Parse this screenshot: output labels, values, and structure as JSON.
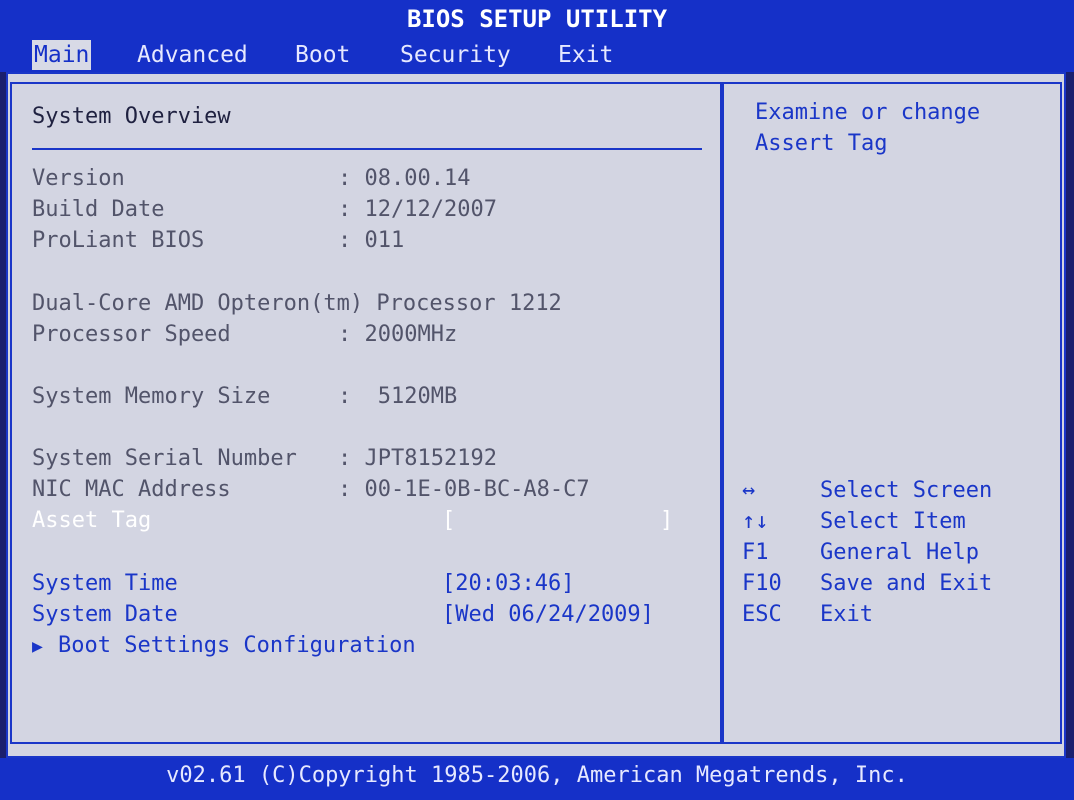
{
  "title": "BIOS SETUP UTILITY",
  "menu": [
    "Main",
    "Advanced",
    "Boot",
    "Security",
    "Exit"
  ],
  "section_title": "System Overview",
  "info": {
    "version_label": "Version",
    "version_value": ": 08.00.14",
    "build_label": "Build Date",
    "build_value": ": 12/12/2007",
    "proliant_label": "ProLiant BIOS",
    "proliant_value": ": 011",
    "processor_name": "Dual-Core AMD Opteron(tm) Processor 1212",
    "speed_label": "Processor Speed",
    "speed_value": ": 2000MHz",
    "memory_label": "System Memory Size",
    "memory_value": ":  5120MB",
    "serial_label": "System Serial Number",
    "serial_value": ": JPT8152192",
    "mac_label": "NIC MAC Address",
    "mac_value": ": 00-1E-0B-BC-A8-C7"
  },
  "asset_tag": {
    "label": "Asset Tag",
    "open_bracket": "[",
    "close_bracket": "]"
  },
  "system_time": {
    "label": "System Time",
    "value": "[20:03:46]"
  },
  "system_date": {
    "label": "System Date",
    "value": "[Wed 06/24/2009]"
  },
  "submenu": {
    "arrow": "▶",
    "label": "Boot Settings Configuration"
  },
  "help": {
    "line1": "Examine or change",
    "line2": "Assert Tag"
  },
  "keys": [
    {
      "key": "↔",
      "action": "Select Screen"
    },
    {
      "key": "↑↓",
      "action": "Select Item"
    },
    {
      "key": "F1",
      "action": "General Help"
    },
    {
      "key": "F10",
      "action": "Save and Exit"
    },
    {
      "key": "ESC",
      "action": "Exit"
    }
  ],
  "footer": "v02.61 (C)Copyright 1985-2006, American Megatrends, Inc."
}
